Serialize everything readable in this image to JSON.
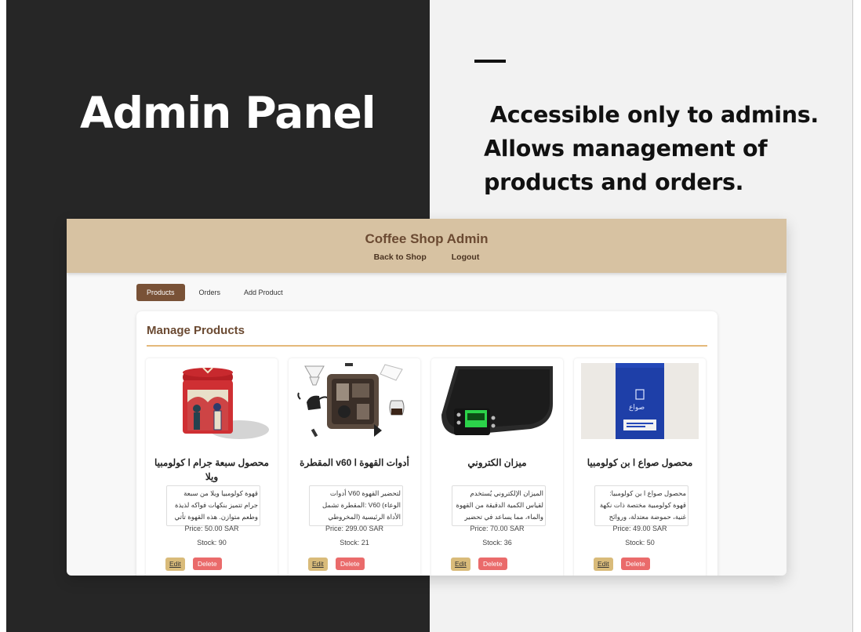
{
  "slide": {
    "title": "Admin Panel",
    "description_line1": "Accessible only to admins.",
    "description_line2": "Allows management of",
    "description_line3": "products and orders."
  },
  "app": {
    "title": "Coffee Shop Admin",
    "nav": {
      "back_to_shop": "Back to Shop",
      "logout": "Logout"
    },
    "tabs": [
      "Products",
      "Orders",
      "Add Product"
    ],
    "active_tab": "Products",
    "section_title": "Manage Products",
    "edit_label": "Edit",
    "delete_label": "Delete",
    "products": [
      {
        "name": "محصول سبعة جرام ا كولومبيا ويلا",
        "description": "قهوة كولومبيا ويلا من سبعة جرام تتميز بنكهات فواكه لذيذة وطعم متوازن. هذه القهوة تأتي",
        "price": "Price: 50.00 SAR",
        "stock": "Stock: 90"
      },
      {
        "name": "أدوات القهوة ا v60 المقطرة",
        "description": "لتحضير القهوة V60 أدوات الوعاء) V60 :المقطرة تشمل الأداة الرئيسية (المخروطي",
        "price": "Price: 299.00 SAR",
        "stock": "Stock: 21"
      },
      {
        "name": "ميزان الكتروني",
        "description": "الميزان الإلكتروني يُستخدم لقياس الكمية الدقيقة من القهوة والماء، مما يساعد في تحضير",
        "price": "Price: 70.00 SAR",
        "stock": "Stock: 36"
      },
      {
        "name": "محصول صواع ا بن كولومبيا",
        "description": "محصول صواع ا بن كولومبيا: قهوة كولومبية مختصة ذات نكهة غنية، حموضة معتدلة، وروائح",
        "price": "Price: 49.00 SAR",
        "stock": "Stock: 50"
      }
    ],
    "bag_brand_text": "صواع"
  },
  "colors": {
    "header_bg": "#d7c2a2",
    "brand_brown": "#6b4a32",
    "active_tab": "#795237",
    "edit_button": "#d9bb7a",
    "delete_button": "#ea6b6b"
  }
}
